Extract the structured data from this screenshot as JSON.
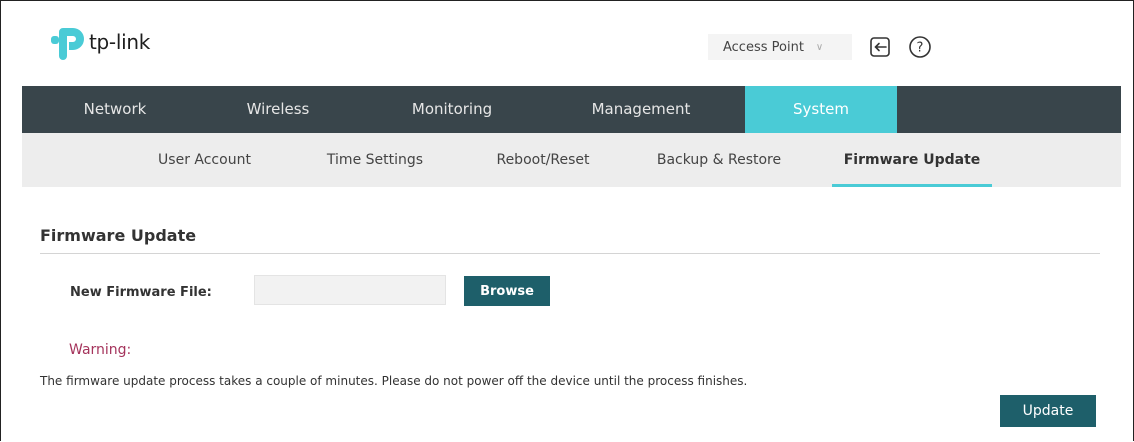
{
  "brand": {
    "logo_text": "tp-link",
    "accent": "#4acbd6",
    "nav_bg": "#39454b",
    "button_bg": "#1e5f6a",
    "warning_color": "#a5345c"
  },
  "header": {
    "mode": "Access Point",
    "logout_icon": "logout-icon",
    "help_icon": "help-icon"
  },
  "main_nav": [
    {
      "label": "Network"
    },
    {
      "label": "Wireless"
    },
    {
      "label": "Monitoring"
    },
    {
      "label": "Management"
    },
    {
      "label": "System",
      "active": true
    }
  ],
  "sub_nav": [
    {
      "label": "User Account"
    },
    {
      "label": "Time Settings"
    },
    {
      "label": "Reboot/Reset"
    },
    {
      "label": "Backup & Restore"
    },
    {
      "label": "Firmware Update",
      "active": true
    }
  ],
  "content": {
    "section_title": "Firmware Update",
    "file_label": "New Firmware File:",
    "file_value": "",
    "browse_label": "Browse",
    "warning_label": "Warning:",
    "message": "The firmware update process takes a couple of minutes. Please do not power off the device until the process finishes.",
    "update_label": "Update"
  }
}
